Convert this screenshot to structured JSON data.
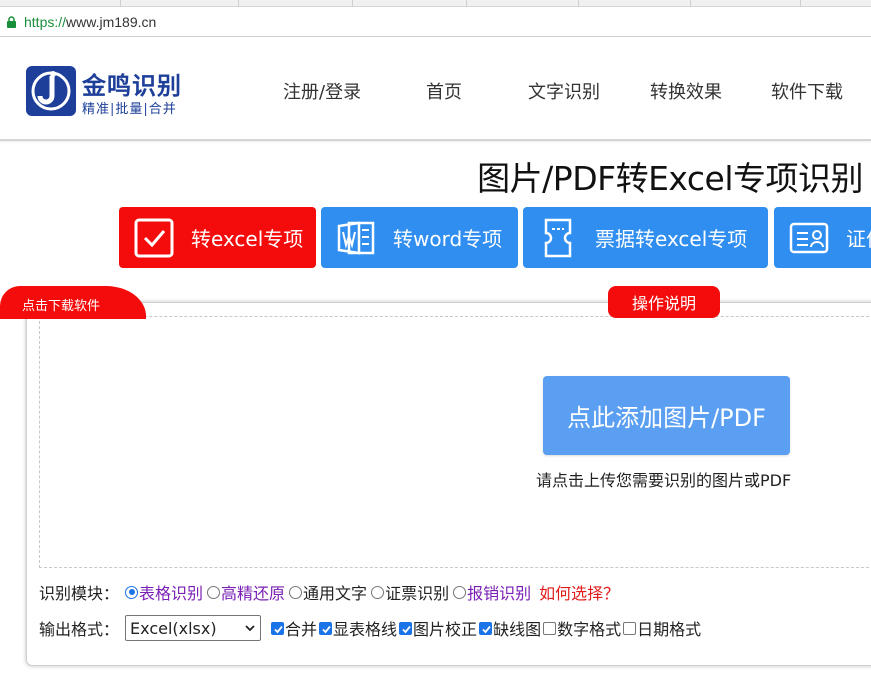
{
  "browser": {
    "url_scheme": "https://",
    "url_rest": "www.jm189.cn"
  },
  "logo": {
    "title": "金鸣识别",
    "subtitle": "精准|批量|合并"
  },
  "nav": {
    "items": [
      {
        "label": "注册/登录"
      },
      {
        "label": "首页"
      },
      {
        "label": "文字识别"
      },
      {
        "label": "转换效果"
      },
      {
        "label": "软件下载"
      }
    ]
  },
  "page": {
    "title": "图片/PDF转Excel专项识别"
  },
  "modes": [
    {
      "label": "转excel专项",
      "icon": "checkbox-icon",
      "color": "#f40b0b"
    },
    {
      "label": "转word专项",
      "icon": "word-icon",
      "color": "#2f8ef0"
    },
    {
      "label": "票据转excel专项",
      "icon": "ticket-icon",
      "color": "#2f8ef0"
    },
    {
      "label": "证件",
      "icon": "id-card-icon",
      "color": "#2f8ef0"
    }
  ],
  "panel": {
    "download_tab": "点击下载软件",
    "help_button": "操作说明",
    "upload_button": "点此添加图片/PDF",
    "upload_hint": "请点击上传您需要识别的图片或PDF"
  },
  "options": {
    "module_label": "识别模块：",
    "modules": [
      {
        "label": "表格识别",
        "selected": true
      },
      {
        "label": "高精还原",
        "selected": false
      },
      {
        "label": "通用文字",
        "selected": false
      },
      {
        "label": "证票识别",
        "selected": false
      },
      {
        "label": "报销识别",
        "selected": false
      }
    ],
    "how_to_choose": "如何选择？",
    "format_label": "输出格式：",
    "format_value": "Excel(xlsx)",
    "checks": [
      {
        "label": "合并",
        "checked": true
      },
      {
        "label": "显表格线",
        "checked": true
      },
      {
        "label": "图片校正",
        "checked": true
      },
      {
        "label": "缺线图",
        "checked": true
      },
      {
        "label": "数字格式",
        "checked": false
      },
      {
        "label": "日期格式",
        "checked": false
      }
    ]
  },
  "colors": {
    "accent_red": "#f40b0b",
    "accent_blue": "#2f8ef0",
    "upload_blue": "#5a9ff1",
    "brand_blue": "#1d3f9a"
  }
}
